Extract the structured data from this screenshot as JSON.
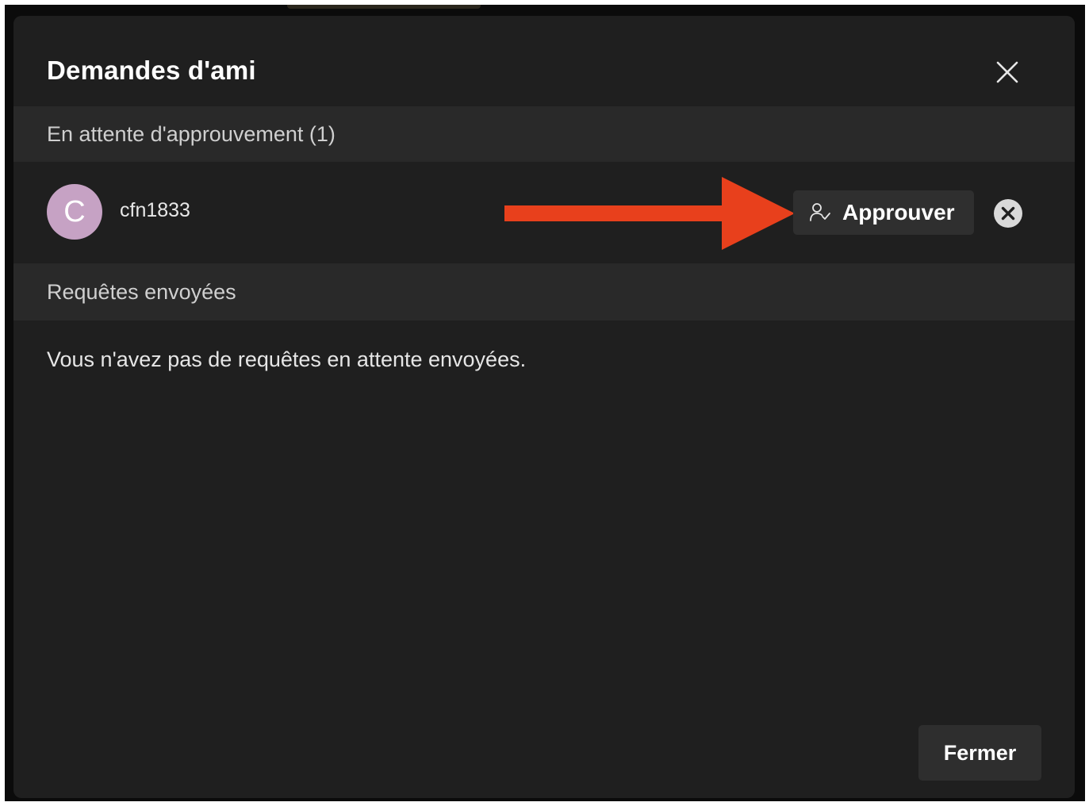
{
  "dialog": {
    "title": "Demandes d'ami",
    "close_icon": "close-icon"
  },
  "pending": {
    "header": "En attente d'approuvement (1)",
    "requests": [
      {
        "avatar_initial": "C",
        "avatar_color": "#c6a2c4",
        "username": "cfn1833",
        "approve_label": "Approuver",
        "approve_icon": "person-check-icon",
        "decline_icon": "close-circle-icon"
      }
    ]
  },
  "sent": {
    "header": "Requêtes envoyées",
    "empty_message": "Vous n'avez pas de requêtes en attente envoyées."
  },
  "footer": {
    "close_label": "Fermer"
  },
  "colors": {
    "dialog_background": "#1f1f1f",
    "section_header_background": "#292929",
    "annotation_arrow": "#e8401c"
  }
}
